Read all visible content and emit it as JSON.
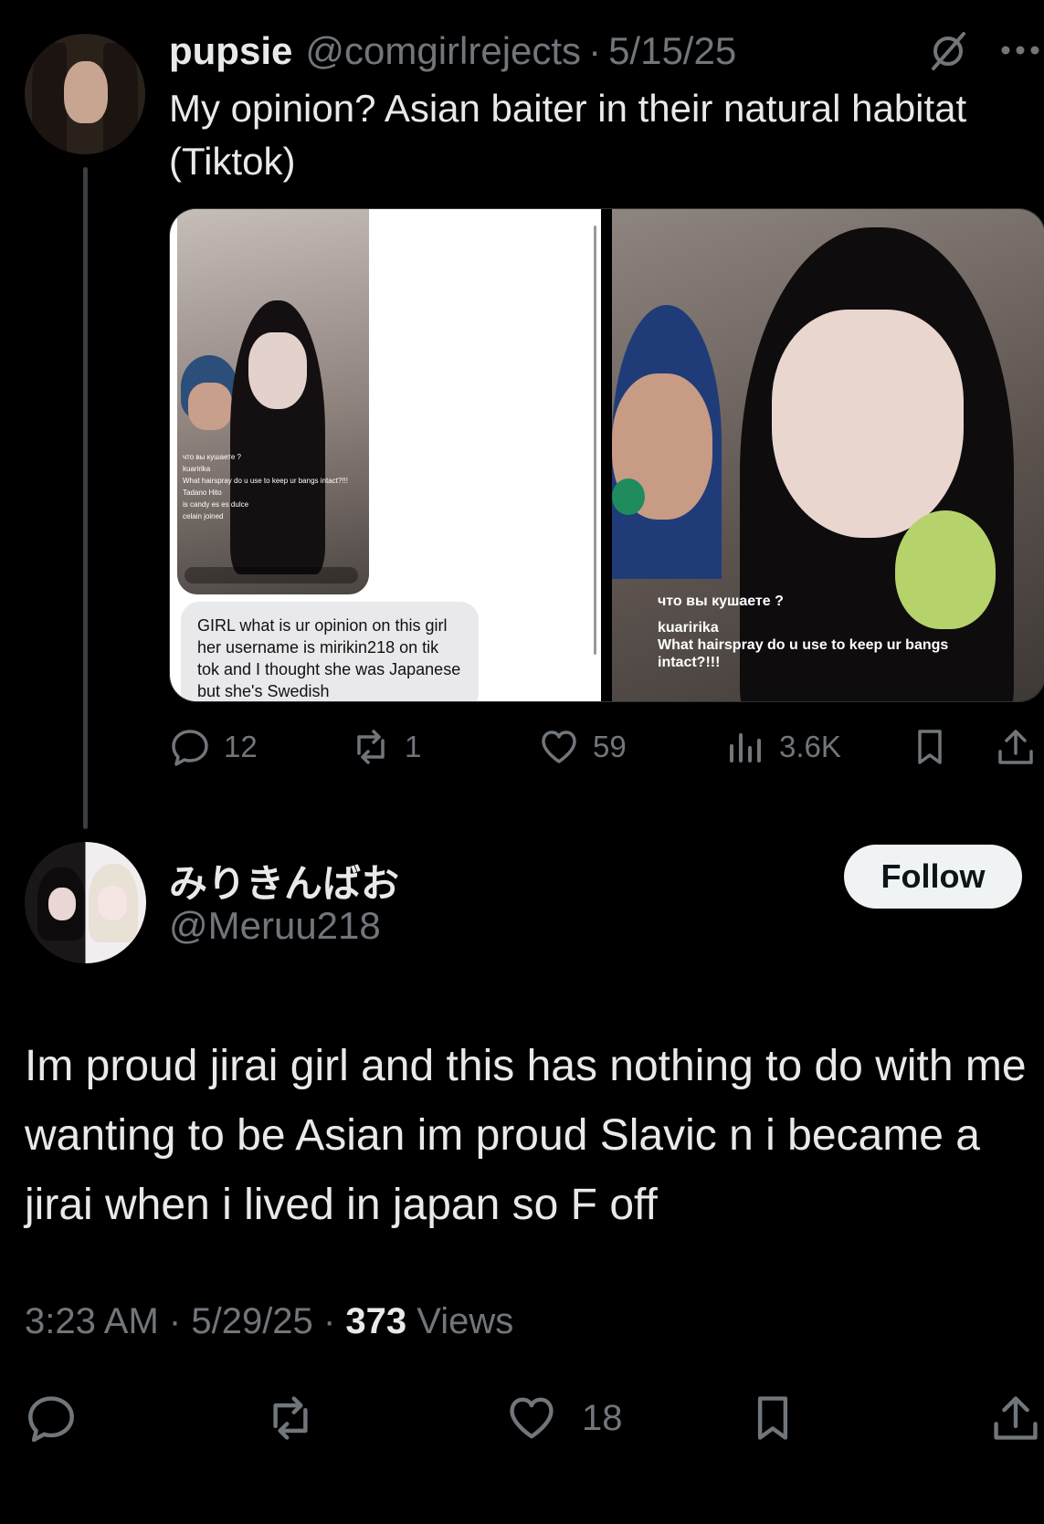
{
  "parent_tweet": {
    "display_name": "pupsie",
    "handle": "@comgirlrejects",
    "separator": "·",
    "date": "5/15/25",
    "text": "My opinion? Asian baiter in their natural habitat (Tiktok)",
    "media": {
      "bubble_text": "GIRL what is ur opinion on this girl her username is mirikin218 on tik tok and I thought she was Japanese but she's Swedish",
      "phone_comments": [
        "что вы кушаете ?",
        "kuaririka",
        "What hairspray do u use to keep ur bangs intact?!!!",
        "Tadano Hito",
        "is candy es es dulce",
        "celain joined"
      ],
      "right_comments": [
        "что вы кушаете ?",
        "kuaririka",
        "What hairspray do u use to keep ur bangs intact?!!!"
      ]
    },
    "actions": {
      "replies": "12",
      "reposts": "1",
      "likes": "59",
      "views": "3.6K"
    }
  },
  "main_tweet": {
    "display_name": "みりきんばお",
    "handle": "@Meruu218",
    "follow_label": "Follow",
    "text": "Im proud jirai girl and this has nothing to do with me wanting to be Asian im proud Slavic n i became a jirai when i lived in japan so F off",
    "time": "3:23 AM",
    "date": "5/29/25",
    "separator": "·",
    "views_count": "373",
    "views_label": "Views",
    "actions": {
      "likes": "18"
    }
  },
  "colors": {
    "background": "#000000",
    "text_primary": "#e7e9ea",
    "text_secondary": "#71767b",
    "follow_bg": "#eff3f4"
  }
}
